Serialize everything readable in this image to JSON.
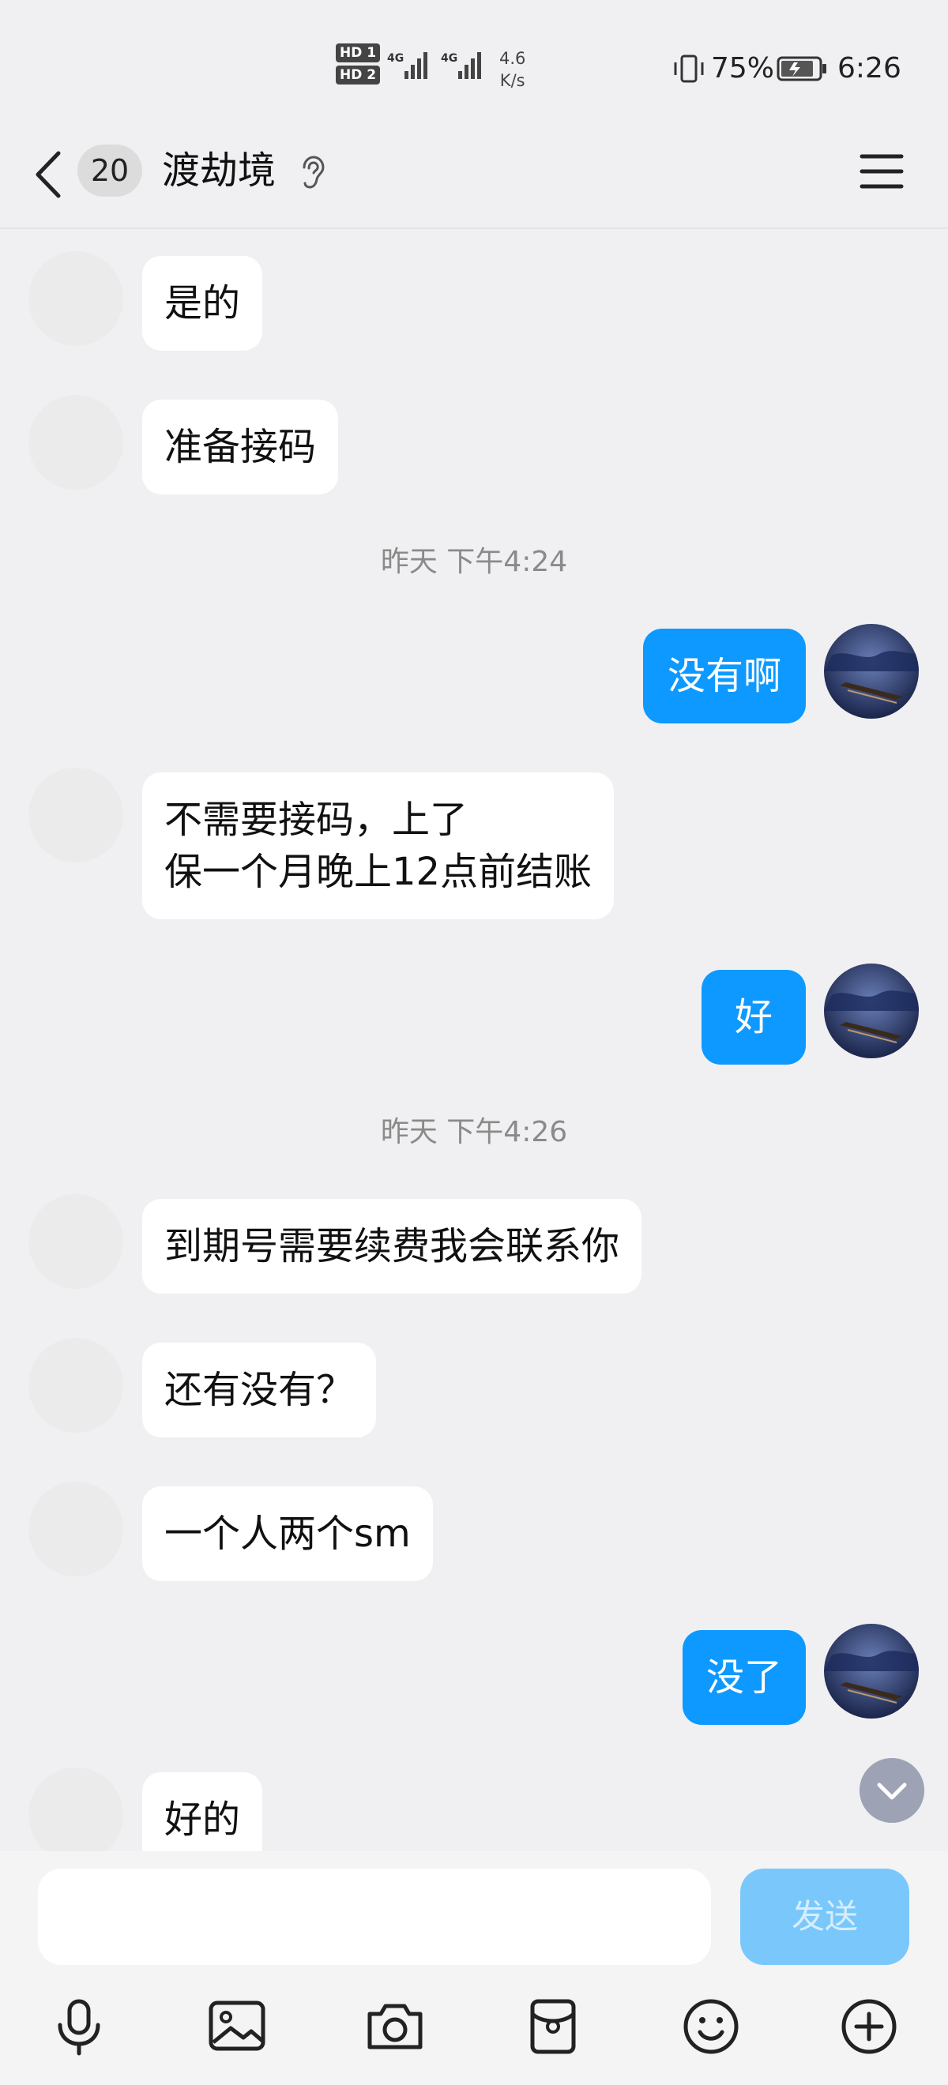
{
  "status_bar": {
    "hd1": "HD 1",
    "hd2": "HD 2",
    "net1": "4G",
    "net2": "4G",
    "speed_value": "4.6",
    "speed_unit": "K/s",
    "battery": "75%",
    "time": "6:26"
  },
  "header": {
    "back_icon": "chevron-left-icon",
    "unread_count": "20",
    "title": "渡劫境",
    "earpiece_icon": "ear-icon",
    "menu_icon": "hamburger-menu-icon"
  },
  "messages": [
    {
      "side": "left",
      "text": "是的"
    },
    {
      "side": "left",
      "text": "准备接码"
    },
    {
      "type": "time",
      "text": "昨天 下午4:24"
    },
    {
      "side": "right",
      "text": "没有啊"
    },
    {
      "side": "left",
      "lines": [
        "不需要接码，上了",
        "保一个月晚上12点前结账"
      ]
    },
    {
      "side": "right",
      "text": "好"
    },
    {
      "type": "time",
      "text": "昨天 下午4:26"
    },
    {
      "side": "left",
      "text": "到期号需要续费我会联系你"
    },
    {
      "side": "left",
      "text": "还有没有？"
    },
    {
      "side": "left",
      "text": "一个人两个sm"
    },
    {
      "side": "right",
      "text": "没了"
    },
    {
      "side": "left",
      "text": "好的"
    }
  ],
  "input": {
    "value": "",
    "send_label": "发送"
  },
  "toolbar": [
    "microphone-icon",
    "image-icon",
    "camera-icon",
    "red-packet-icon",
    "emoji-icon",
    "plus-icon"
  ],
  "colors": {
    "accent": "#0d99ff",
    "send_disabled": "#7ac8fb",
    "background": "#f0f0f2"
  }
}
